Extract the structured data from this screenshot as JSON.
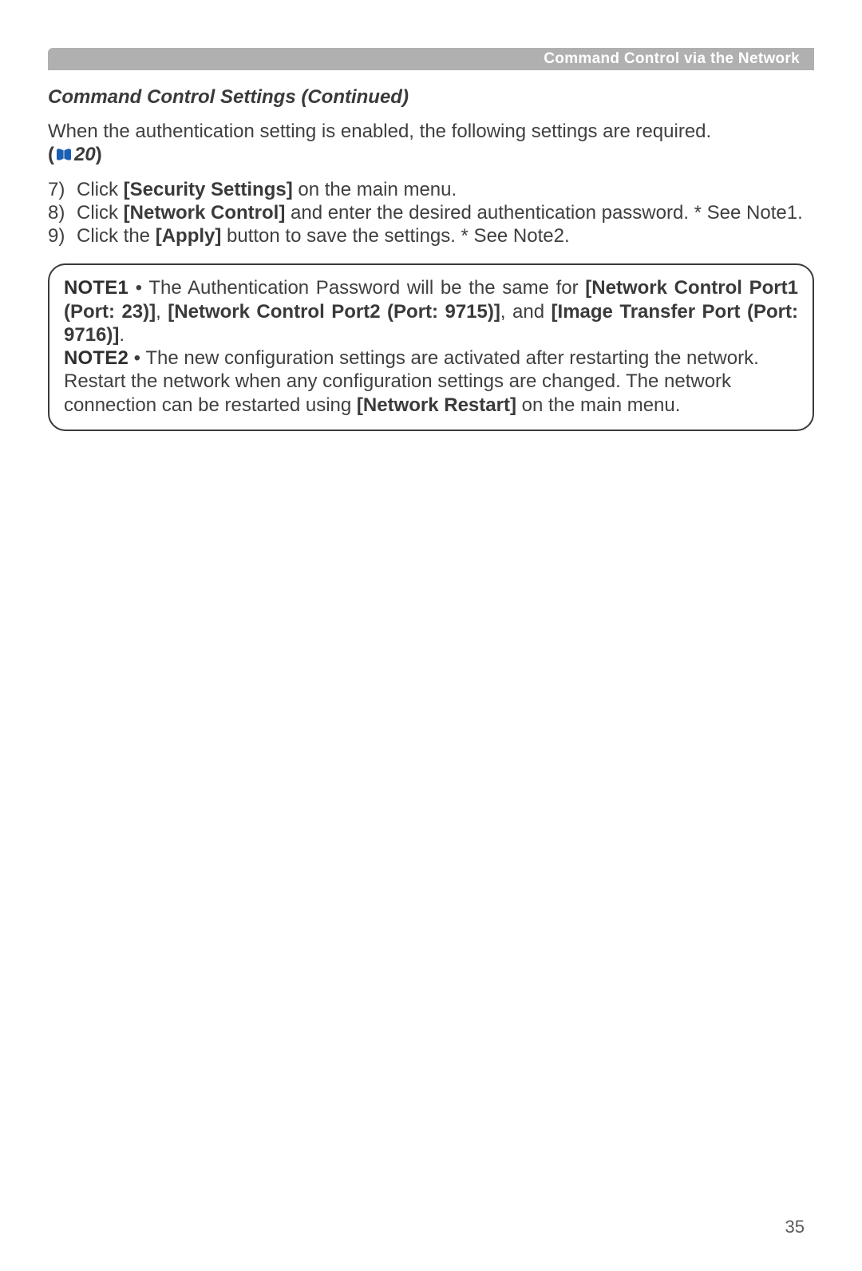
{
  "header": {
    "title": "Command Control via the Network"
  },
  "section_title": "Command Control Settings (Continued)",
  "intro": {
    "text": "When the authentication setting is enabled, the following settings are required.",
    "ref_open": "(",
    "ref_num": "20",
    "ref_close": ")"
  },
  "steps": [
    {
      "num": "7)",
      "pre": "Click ",
      "bold": "[Security Settings]",
      "post": " on the main menu."
    },
    {
      "num": "8)",
      "pre": "Click ",
      "bold": "[Network Control]",
      "post": " and enter the desired authentication password. * See Note1."
    },
    {
      "num": "9)",
      "pre": "Click the ",
      "bold": "[Apply]",
      "post": " button to save the settings. * See Note2."
    }
  ],
  "notes": {
    "note1": {
      "label": "NOTE1",
      "sep": "  •  ",
      "t1": "The Authentication Password will be the same for ",
      "b1": "[Network Control Port1 (Port: 23)]",
      "t2": ", ",
      "b2": "[Network Control Port2 (Port: 9715)]",
      "t3": ", and ",
      "b3": "[Image Transfer Port (Port: 9716)]",
      "t4": "."
    },
    "note2": {
      "label": "NOTE2",
      "sep": "  •  ",
      "t1": "The new configuration settings are activated after restarting the network. Restart the network when any configuration settings are changed. The network connection can be restarted using ",
      "b1": "[Network Restart]",
      "t2": " on the main menu."
    }
  },
  "page_number": "35"
}
